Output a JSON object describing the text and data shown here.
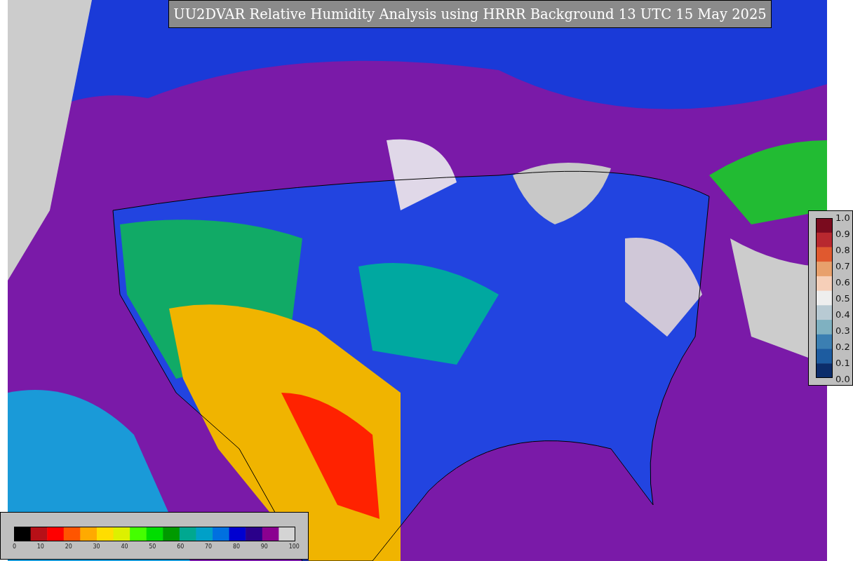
{
  "title": "UU2DVAR Relative Humidity Analysis using HRRR Background 13 UTC 15 May 2025",
  "station_colorbar": {
    "ticks": [
      "1.0",
      "0.9",
      "0.8",
      "0.7",
      "0.6",
      "0.5",
      "0.4",
      "0.3",
      "0.2",
      "0.1",
      "0.0"
    ]
  },
  "humidity_colorbar": {
    "ticks": [
      "0",
      "10",
      "20",
      "30",
      "40",
      "50",
      "60",
      "70",
      "80",
      "90",
      "100"
    ]
  }
}
